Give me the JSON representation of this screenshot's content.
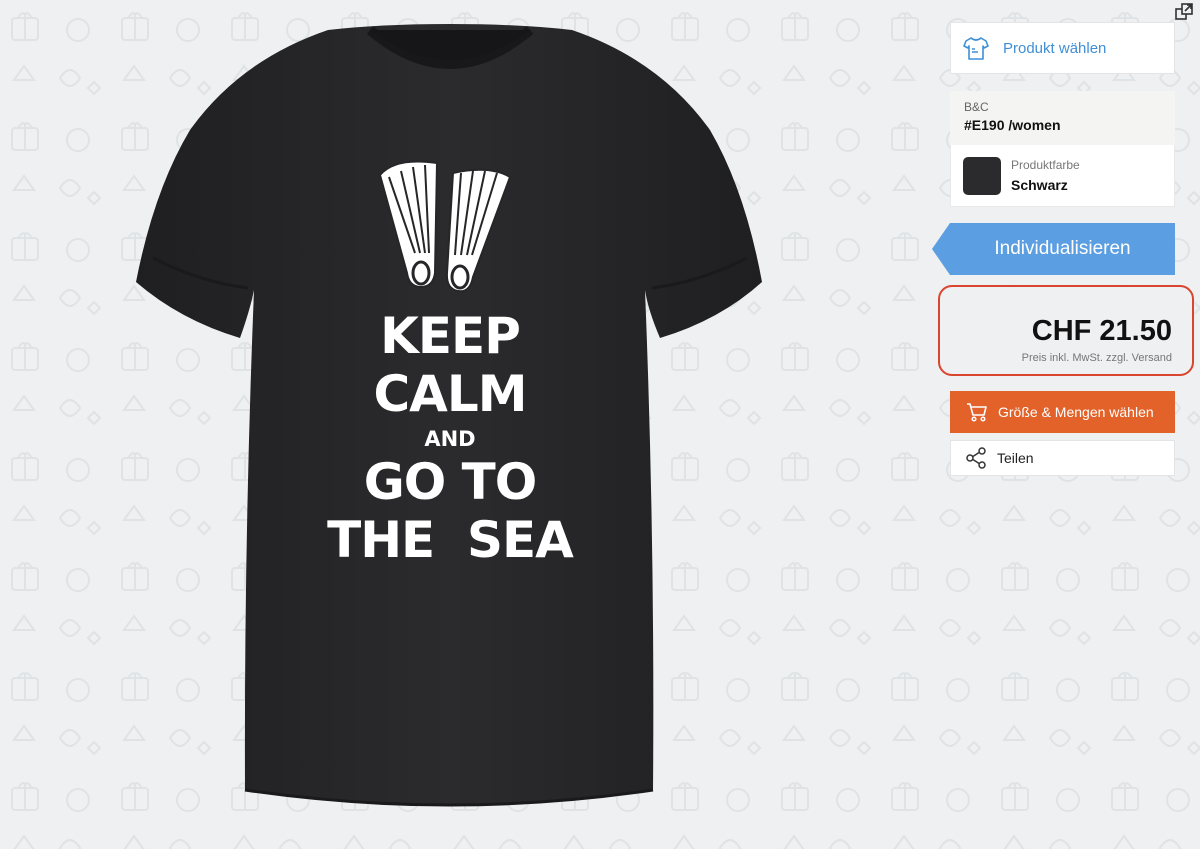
{
  "colors": {
    "background": "#eef0f1",
    "accent_blue": "#3f8fd6",
    "customize_blue": "#5b9ee1",
    "order_orange": "#e2622a",
    "highlight_red": "#d9452e",
    "shirt": "#262628"
  },
  "toolbar": {
    "external_link_icon": "external-link-icon"
  },
  "product_preview": {
    "print_lines": [
      "KEEP",
      "CALM",
      "AND",
      "GO TO",
      "THE  SEA"
    ],
    "print_graphic": "diving-fins-graphic"
  },
  "sidebar": {
    "choose_product": {
      "icon": "tshirt-icon",
      "label": "Produkt wählen"
    },
    "product": {
      "brand": "B&C",
      "model": "#E190 /women"
    },
    "color": {
      "label": "Produktfarbe",
      "value": "Schwarz",
      "swatch": "#2b2b2d"
    },
    "customize_label": "Individualisieren",
    "price": {
      "amount": "CHF 21.50",
      "note": "Preis inkl. MwSt. zzgl. Versand"
    },
    "size_quantity": {
      "icon": "cart-icon",
      "label": "Größe & Mengen wählen"
    },
    "share": {
      "icon": "share-icon",
      "label": "Teilen"
    }
  }
}
